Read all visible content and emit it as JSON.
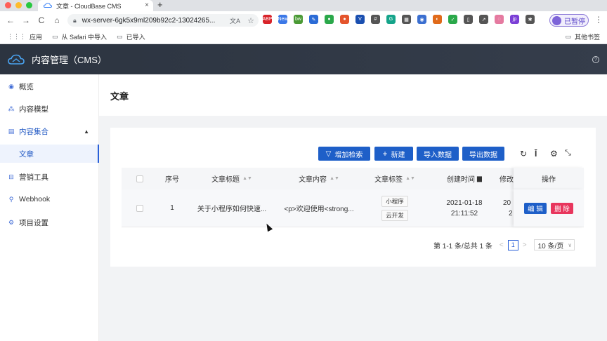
{
  "browser": {
    "tab_title": "文章 - CloudBase CMS",
    "tab_close": "×",
    "new_tab": "+",
    "url": "wx-server-6gk5x9ml209b92c2-13024265...",
    "nav": {
      "back": "←",
      "forward": "→",
      "reload": "C",
      "home": "⌂"
    },
    "profile_label": "已暂停",
    "menu": "⋮",
    "extensions": [
      {
        "name": "adblock-plus-icon",
        "label": "ABP",
        "color": "#d8232a"
      },
      {
        "name": "new-badge-icon",
        "label": "New",
        "color": "#3b78e7"
      },
      {
        "name": "bw-icon",
        "label": "bw",
        "color": "#4a9a35"
      },
      {
        "name": "pen-icon",
        "label": "✎",
        "color": "#2b6bd6"
      },
      {
        "name": "evernote-icon",
        "label": "●",
        "color": "#2aa84a"
      },
      {
        "name": "circle-orange-icon",
        "label": "●",
        "color": "#e4542c"
      },
      {
        "name": "v-icon",
        "label": "V",
        "color": "#1a4fb0"
      },
      {
        "name": "hash-icon",
        "label": "#",
        "color": "#555555"
      },
      {
        "name": "grammarly-icon",
        "label": "G",
        "color": "#15a48a"
      },
      {
        "name": "qr-icon",
        "label": "▦",
        "color": "#555555"
      },
      {
        "name": "camera-icon",
        "label": "◉",
        "color": "#3b6fd0"
      },
      {
        "name": "eye-icon",
        "label": "◐",
        "color": "#e06a1a"
      },
      {
        "name": "shield-icon",
        "label": "✓",
        "color": "#2aa84a"
      },
      {
        "name": "bookmark-icon",
        "label": "▯",
        "color": "#555555"
      },
      {
        "name": "chart-icon",
        "label": "↗",
        "color": "#555555"
      },
      {
        "name": "ghost-icon",
        "label": "◌",
        "color": "#e57aa0"
      },
      {
        "name": "jp-icon",
        "label": "jp",
        "color": "#7b3fd6"
      },
      {
        "name": "puzzle-icon",
        "label": "✱",
        "color": "#555555"
      }
    ],
    "bookmarks": [
      {
        "name": "bookmark-apps",
        "icon": "grid-icon",
        "label": "应用"
      },
      {
        "name": "bookmark-safari-import",
        "icon": "folder-icon",
        "label": "从 Safari 中导入"
      },
      {
        "name": "bookmark-imported",
        "icon": "folder-icon",
        "label": "已导入"
      }
    ],
    "other_bookmarks": "其他书签"
  },
  "app": {
    "title": "内容管理（CMS）",
    "help_icon": "?"
  },
  "sidebar": {
    "items": [
      {
        "label": "概览",
        "icon": "eye-icon"
      },
      {
        "label": "内容模型",
        "icon": "model-icon"
      },
      {
        "label": "内容集合",
        "icon": "collection-icon",
        "caret": "▲"
      },
      {
        "label": "文章",
        "icon": "",
        "active": true
      },
      {
        "label": "营销工具",
        "icon": "shop-icon"
      },
      {
        "label": "Webhook",
        "icon": "webhook-icon"
      },
      {
        "label": "项目设置",
        "icon": "gear-icon"
      }
    ]
  },
  "page": {
    "title": "文章"
  },
  "toolbar": {
    "add_filter": "增加检索",
    "new": "新建",
    "import": "导入数据",
    "export": "导出数据",
    "filter_icon": "▽",
    "plus_icon": "+"
  },
  "table": {
    "headers": {
      "index": "序号",
      "title": "文章标题",
      "content": "文章内容",
      "tags": "文章标签",
      "created": "创建时间",
      "modified": "修改",
      "actions": "操作"
    },
    "rows": [
      {
        "index": "1",
        "title": "关于小程序如何快速...",
        "content": "<p>欢迎使用<strong...",
        "tags": [
          "小程序",
          "云开发"
        ],
        "created_date": "2021-01-18",
        "created_time": "21:11:52",
        "modified_date": "20",
        "modified_time": "2",
        "edit": "编 辑",
        "delete": "删 除"
      }
    ]
  },
  "pagination": {
    "summary": "第 1-1 条/总共 1 条",
    "prev": "<",
    "current": "1",
    "next": ">",
    "page_size": "10 条/页"
  },
  "colors": {
    "primary": "#1e5fc8",
    "danger": "#e8365d",
    "header_bg": "#2c3440"
  }
}
